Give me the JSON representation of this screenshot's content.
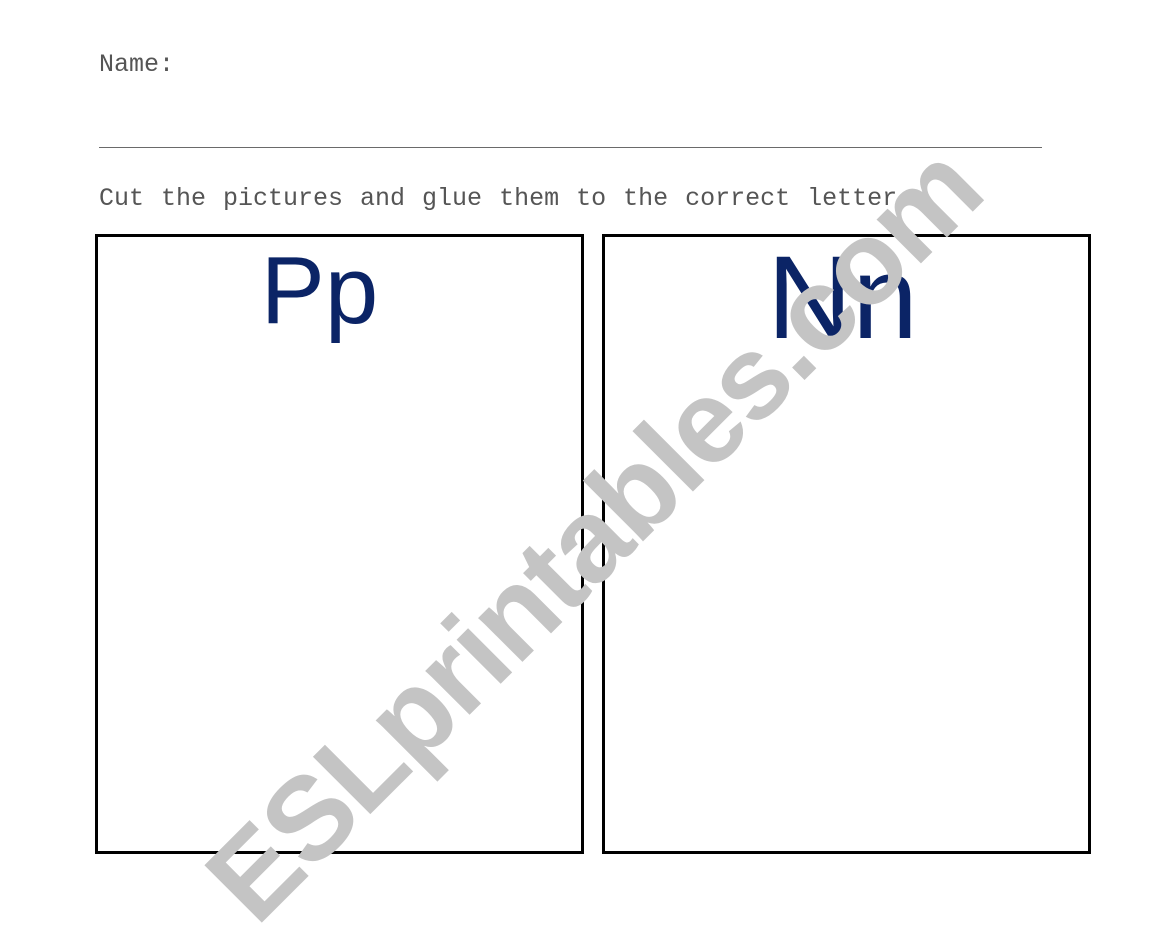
{
  "worksheet": {
    "name_label": "Name:",
    "instruction": "Cut the pictures and glue them to the correct letter",
    "boxes": [
      {
        "letter": "Pp"
      },
      {
        "letter": "Nn"
      }
    ],
    "watermark": "ESLprintables.com",
    "colors": {
      "letter": "#0b2466",
      "text": "#555555",
      "watermark": "#c4c4c4",
      "border": "#000000"
    }
  }
}
